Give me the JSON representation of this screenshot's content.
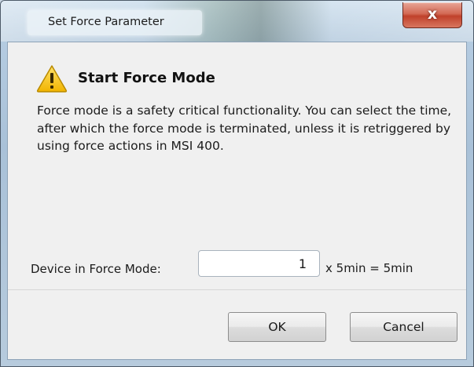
{
  "window": {
    "title": "Set Force Parameter",
    "close_label": "x"
  },
  "dialog": {
    "heading": "Start Force Mode",
    "message": "Force mode is a safety critical functionality. You can select the time, after which the force mode is terminated, unless it is retriggered by using force actions in MSI 400.",
    "field_label": "Device in Force Mode:",
    "field_value": "1",
    "field_suffix": "x 5min = 5min"
  },
  "buttons": {
    "ok_label": "OK",
    "cancel_label": "Cancel"
  },
  "icons": {
    "warning": "warning-icon",
    "close": "close-icon"
  },
  "colors": {
    "warning_fill": "#f5c400",
    "close_button": "#c7452f",
    "window_frame": "#b4c9dd"
  }
}
